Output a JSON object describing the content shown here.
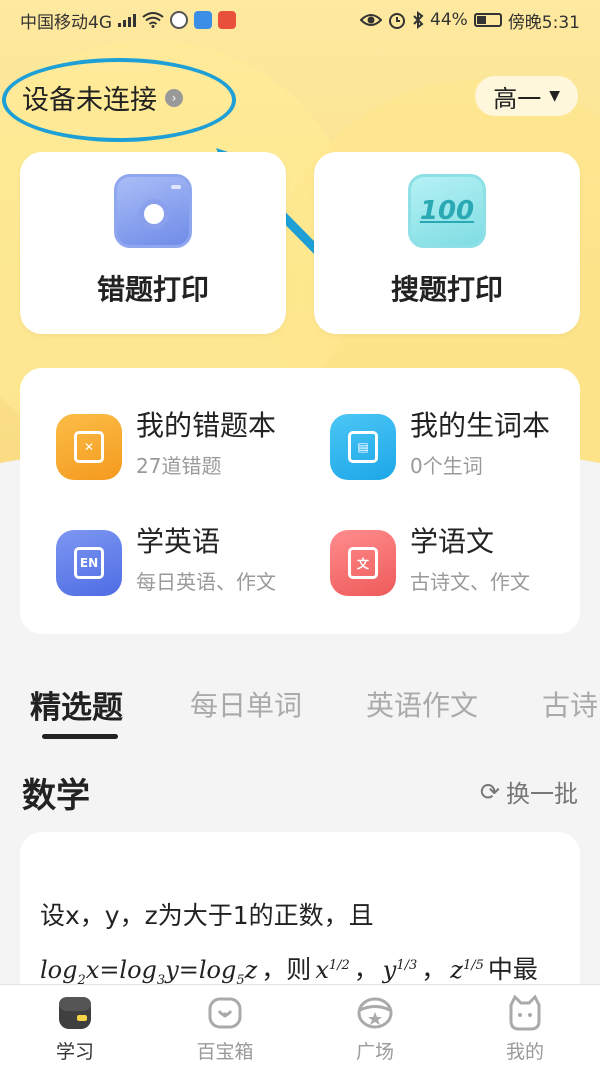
{
  "status_bar": {
    "carrier": "中国移动4G",
    "network_type": "4G",
    "battery": "44%",
    "battery_level": 0.44,
    "time": "傍晚5:31"
  },
  "header": {
    "device_status": "设备未连接",
    "grade": "高一"
  },
  "big_cards": [
    {
      "label": "错题打印",
      "icon": "camera-icon"
    },
    {
      "label": "搜题打印",
      "icon": "score-100-icon",
      "icon_text": "100"
    }
  ],
  "features": [
    {
      "title": "我的错题本",
      "subtitle": "27道错题",
      "icon": "mistake-book-icon",
      "color": "#f5a524"
    },
    {
      "title": "我的生词本",
      "subtitle": "0个生词",
      "icon": "vocabulary-book-icon",
      "color": "#24b0ee"
    },
    {
      "title": "学英语",
      "subtitle": "每日英语、作文",
      "icon": "english-icon",
      "icon_text": "EN",
      "color": "#5b78e6"
    },
    {
      "title": "学语文",
      "subtitle": "古诗文、作文",
      "icon": "chinese-icon",
      "icon_text": "文",
      "color": "#f16464"
    }
  ],
  "tabs": [
    {
      "label": "精选题",
      "active": true
    },
    {
      "label": "每日单词",
      "active": false
    },
    {
      "label": "英语作文",
      "active": false
    },
    {
      "label": "古诗",
      "active": false
    }
  ],
  "section": {
    "title": "数学",
    "refresh_label": "换一批"
  },
  "question": {
    "line1": "设x，y，z为大于1的正数，且",
    "eq_part1": "log",
    "eq_sub1": "2",
    "eq_part2": "x=log",
    "eq_sub2": "3",
    "eq_part3": "y=log",
    "eq_sub3": "5",
    "eq_part4": "z",
    "then": "，则",
    "x_term": "x",
    "x_exp": "1/2",
    "y_term": "y",
    "y_exp": "1/3",
    "z_term": "z",
    "z_exp": "1/5",
    "sep": "，",
    "tail": "中最"
  },
  "bottom_nav": [
    {
      "label": "学习",
      "icon": "study-icon",
      "active": true
    },
    {
      "label": "百宝箱",
      "icon": "treasure-box-icon",
      "active": false
    },
    {
      "label": "广场",
      "icon": "square-icon",
      "active": false
    },
    {
      "label": "我的",
      "icon": "profile-icon",
      "active": false
    }
  ],
  "colors": {
    "hero_yellow": "#fbe08a",
    "highlight_blue": "#1e9fd6",
    "active_text": "#222222",
    "muted_text": "#9a9a9a"
  }
}
